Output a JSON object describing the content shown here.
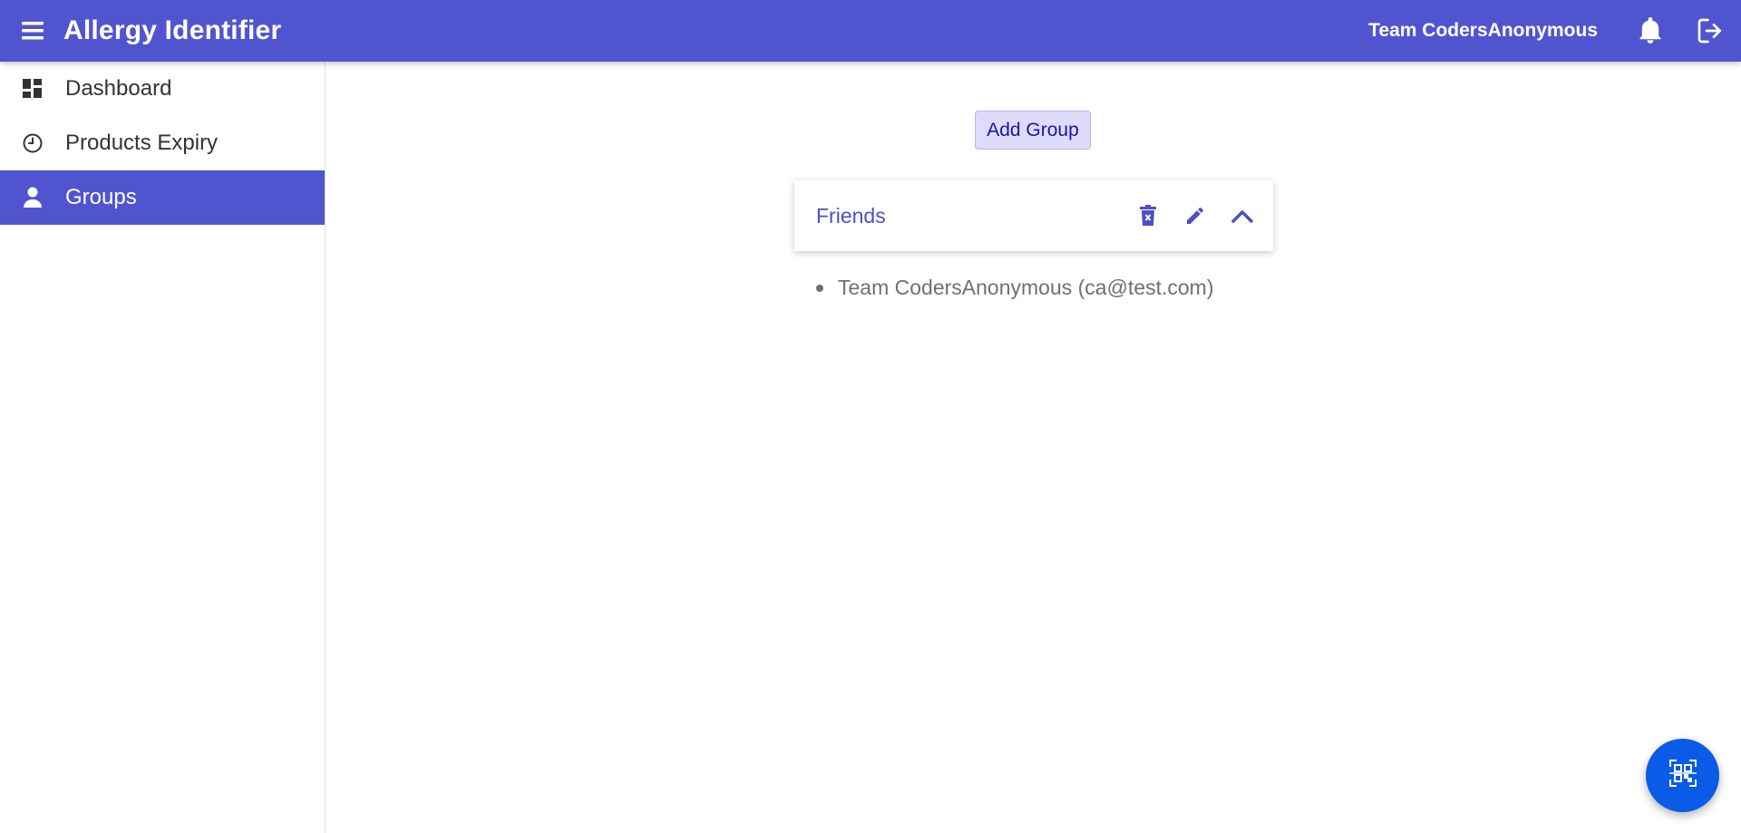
{
  "header": {
    "title": "Allergy Identifier",
    "team_name": "Team CodersAnonymous",
    "menu_icon": "hamburger-menu-icon",
    "notification_icon": "bell-icon",
    "logout_icon": "logout-icon"
  },
  "sidebar": {
    "items": [
      {
        "label": "Dashboard",
        "icon": "dashboard-grid-icon",
        "active": false
      },
      {
        "label": "Products Expiry",
        "icon": "clock-icon",
        "active": false
      },
      {
        "label": "Groups",
        "icon": "person-icon",
        "active": true
      }
    ]
  },
  "main": {
    "add_group_label": "Add Group",
    "groups": [
      {
        "name": "Friends",
        "members": [
          {
            "label": "Team CodersAnonymous (ca@test.com)"
          }
        ]
      }
    ]
  },
  "fab": {
    "icon": "qr-code-scan-icon"
  },
  "colors": {
    "primary": "#5055cf",
    "button_bg": "#dedcfa",
    "button_text": "#1a14a8",
    "fab": "#0a5be6",
    "member_text": "#707070"
  }
}
